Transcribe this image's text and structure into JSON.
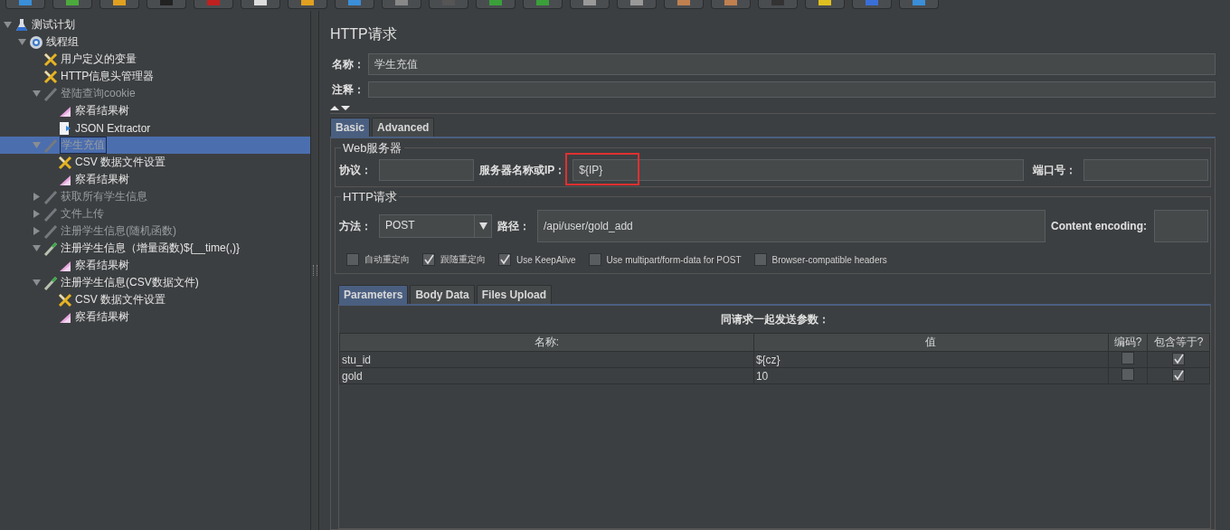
{
  "tree": [
    {
      "label": "测试计划",
      "kind": "plan",
      "expanded": true,
      "selected": false,
      "disabled": false,
      "children": [
        {
          "label": "线程组",
          "kind": "threadgroup",
          "expanded": true,
          "selected": false,
          "disabled": false,
          "children": [
            {
              "label": "用户定义的变量",
              "kind": "config",
              "selected": false,
              "disabled": false
            },
            {
              "label": "HTTP信息头管理器",
              "kind": "config",
              "selected": false,
              "disabled": false
            },
            {
              "label": "登陆查询cookie",
              "kind": "sampler",
              "expanded": true,
              "selected": false,
              "disabled": true,
              "children": [
                {
                  "label": "察看结果树",
                  "kind": "listener",
                  "selected": false,
                  "disabled": false
                },
                {
                  "label": "JSON Extractor",
                  "kind": "extractor",
                  "selected": false,
                  "disabled": false
                }
              ]
            },
            {
              "label": "学生充值",
              "kind": "sampler",
              "expanded": true,
              "selected": true,
              "disabled": true,
              "children": [
                {
                  "label": "CSV 数据文件设置",
                  "kind": "config",
                  "selected": false,
                  "disabled": false
                },
                {
                  "label": "察看结果树",
                  "kind": "listener",
                  "selected": false,
                  "disabled": false
                }
              ]
            },
            {
              "label": "获取所有学生信息",
              "kind": "sampler",
              "expanded": false,
              "selected": false,
              "disabled": true
            },
            {
              "label": "文件上传",
              "kind": "sampler",
              "expanded": false,
              "selected": false,
              "disabled": true
            },
            {
              "label": "注册学生信息(随机函数)",
              "kind": "sampler",
              "expanded": false,
              "selected": false,
              "disabled": true
            },
            {
              "label": "注册学生信息（增量函数)${__time(,)}",
              "kind": "sampler",
              "expanded": true,
              "selected": false,
              "disabled": false,
              "children": [
                {
                  "label": "察看结果树",
                  "kind": "listener",
                  "selected": false,
                  "disabled": false
                }
              ]
            },
            {
              "label": "注册学生信息(CSV数据文件)",
              "kind": "sampler",
              "expanded": true,
              "selected": false,
              "disabled": false,
              "children": [
                {
                  "label": "CSV 数据文件设置",
                  "kind": "config",
                  "selected": false,
                  "disabled": false
                },
                {
                  "label": "察看结果树",
                  "kind": "listener",
                  "selected": false,
                  "disabled": false
                }
              ]
            }
          ]
        }
      ]
    }
  ],
  "panel": {
    "title": "HTTP请求",
    "name_label": "名称：",
    "name_value": "学生充值",
    "comment_label": "注释："
  },
  "tabs": [
    {
      "label": "Basic",
      "selected": true
    },
    {
      "label": "Advanced",
      "selected": false
    }
  ],
  "web_server": {
    "title": "Web服务器",
    "protocol_label": "协议：",
    "server_label": "服务器名称或IP：",
    "server_value": "${IP}",
    "server_highlighted": true,
    "port_label": "端口号："
  },
  "http_request": {
    "title": "HTTP请求",
    "method_label": "方法：",
    "method_value": "POST",
    "path_label": "路径：",
    "path_value": "/api/user/gold_add",
    "encoding_label": "Content encoding:"
  },
  "options": [
    {
      "label": "自动重定向",
      "checked": false
    },
    {
      "label": "跟随重定向",
      "checked": true
    },
    {
      "label": "Use KeepAlive",
      "checked": true
    },
    {
      "label": "Use multipart/form-data for POST",
      "checked": false
    },
    {
      "label": "Browser-compatible headers",
      "checked": false
    }
  ],
  "param_tabs": [
    {
      "label": "Parameters",
      "selected": true
    },
    {
      "label": "Body Data",
      "selected": false
    },
    {
      "label": "Files Upload",
      "selected": false
    }
  ],
  "params": {
    "caption": "同请求一起发送参数：",
    "columns": [
      "名称:",
      "值",
      "编码?",
      "包含等于?"
    ],
    "rows": [
      {
        "name": "stu_id",
        "value": "${cz}",
        "encode": false,
        "include_equals": true
      },
      {
        "name": "gold",
        "value": "10",
        "encode": false,
        "include_equals": true
      }
    ]
  }
}
